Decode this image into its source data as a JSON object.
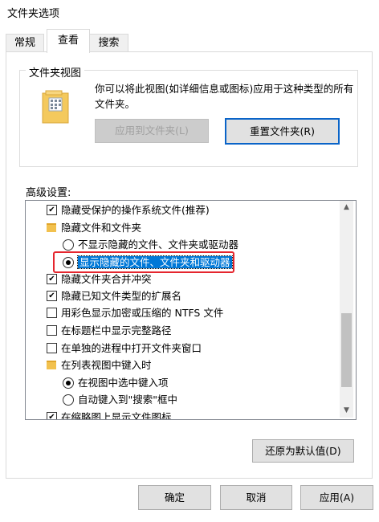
{
  "window": {
    "title": "文件夹选项"
  },
  "tabs": [
    {
      "label": "常规"
    },
    {
      "label": "查看"
    },
    {
      "label": "搜索"
    }
  ],
  "folder_views": {
    "legend": "文件夹视图",
    "description": "你可以将此视图(如详细信息或图标)应用于这种类型的所有文件夹。",
    "apply_button": "应用到文件夹(L)",
    "reset_button": "重置文件夹(R)"
  },
  "advanced": {
    "label": "高级设置:",
    "items": [
      {
        "label": "隐藏受保护的操作系统文件(推荐)",
        "type": "checkbox",
        "checked": true
      },
      {
        "label": "隐藏文件和文件夹",
        "type": "folder"
      },
      {
        "label": "不显示隐藏的文件、文件夹或驱动器",
        "type": "radio",
        "checked": false
      },
      {
        "label": "显示隐藏的文件、文件夹和驱动器",
        "type": "radio",
        "checked": true,
        "selected": true
      },
      {
        "label": "隐藏文件夹合并冲突",
        "type": "checkbox",
        "checked": true
      },
      {
        "label": "隐藏已知文件类型的扩展名",
        "type": "checkbox",
        "checked": true
      },
      {
        "label": "用彩色显示加密或压缩的 NTFS 文件",
        "type": "checkbox",
        "checked": false
      },
      {
        "label": "在标题栏中显示完整路径",
        "type": "checkbox",
        "checked": false
      },
      {
        "label": "在单独的进程中打开文件夹窗口",
        "type": "checkbox",
        "checked": false
      },
      {
        "label": "在列表视图中键入时",
        "type": "folder"
      },
      {
        "label": "在视图中选中键入项",
        "type": "radio",
        "checked": true
      },
      {
        "label": "自动键入到\"搜索\"框中",
        "type": "radio",
        "checked": false
      },
      {
        "label": "在缩略图上显示文件图标",
        "type": "checkbox",
        "checked": true
      }
    ]
  },
  "restore_button": "还原为默认值(D)",
  "footer": {
    "ok": "确定",
    "cancel": "取消",
    "apply": "应用(A)"
  },
  "colors": {
    "selection": "#0078d7",
    "highlight_box": "#e5262e",
    "default_button_border": "#0a64c8"
  }
}
